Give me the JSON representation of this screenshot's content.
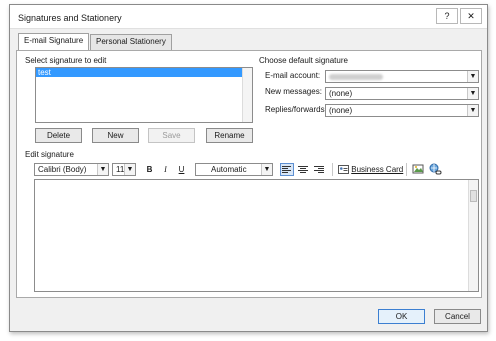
{
  "window": {
    "title": "Signatures and Stationery",
    "help_label": "?",
    "close_label": "✕"
  },
  "tabs": [
    {
      "label": "E-mail Signature",
      "active": true
    },
    {
      "label": "Personal Stationery",
      "active": false
    }
  ],
  "select_signature": {
    "label": "Select signature to edit",
    "items": [
      "test"
    ],
    "buttons": {
      "delete": "Delete",
      "new": "New",
      "save": "Save",
      "rename": "Rename"
    }
  },
  "default_signature": {
    "label": "Choose default signature",
    "email_account_label": "E-mail account:",
    "new_messages_label": "New messages:",
    "new_messages_value": "(none)",
    "replies_label": "Replies/forwards:",
    "replies_value": "(none)"
  },
  "edit_signature": {
    "label": "Edit signature",
    "font": "Calibri (Body)",
    "size": "11",
    "bold": "B",
    "italic": "I",
    "underline": "U",
    "color": "Automatic",
    "business_card": "Business Card"
  },
  "footer": {
    "ok": "OK",
    "cancel": "Cancel"
  },
  "icons": {
    "align_left": "align-left-icon",
    "align_center": "align-center-icon",
    "align_right": "align-right-icon",
    "business_card": "business-card-icon",
    "insert_picture": "insert-picture-icon",
    "insert_hyperlink": "insert-hyperlink-icon"
  }
}
